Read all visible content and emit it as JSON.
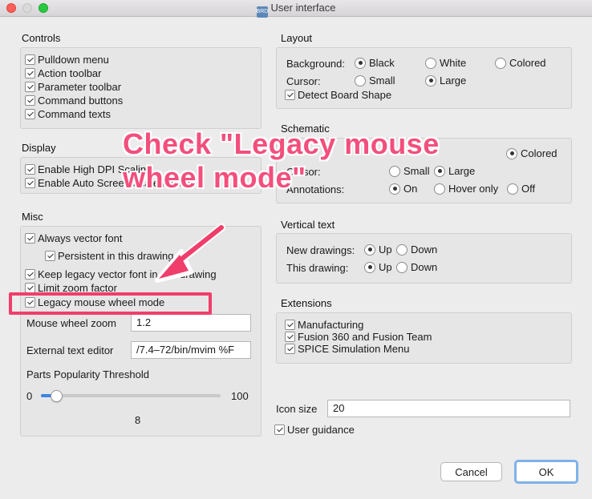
{
  "window": {
    "title": "User interface",
    "app_icon_label": "BRD"
  },
  "colors": {
    "accent": "#3b86e0",
    "annotation": "#f34f7d",
    "highlight_border": "#f03e6b"
  },
  "controls": {
    "title": "Controls",
    "items": [
      "Pulldown menu",
      "Action toolbar",
      "Parameter toolbar",
      "Command buttons",
      "Command texts"
    ]
  },
  "display": {
    "title": "Display",
    "items": [
      "Enable High DPI Scaling",
      "Enable Auto Screen Scale Factor"
    ]
  },
  "misc": {
    "title": "Misc",
    "always_vector_font": "Always vector font",
    "persistent": "Persistent in this drawing",
    "keep_legacy": "Keep legacy vector font in this drawing",
    "limit_zoom": "Limit zoom factor",
    "legacy_mouse": "Legacy mouse wheel mode",
    "mouse_wheel_zoom_label": "Mouse wheel zoom",
    "mouse_wheel_zoom_value": "1.2",
    "external_editor_label": "External text editor",
    "external_editor_value": "/7.4–72/bin/mvim %F",
    "popularity_label": "Parts Popularity Threshold",
    "slider_min": "0",
    "slider_max": "100",
    "slider_value": "8",
    "slider_fraction": 0.08
  },
  "layout": {
    "title": "Layout",
    "background_label": "Background:",
    "background_options": [
      "Black",
      "White",
      "Colored"
    ],
    "cursor_label": "Cursor:",
    "cursor_options": [
      "Small",
      "Large"
    ],
    "detect_board_shape": "Detect Board Shape"
  },
  "schematic": {
    "title": "Schematic",
    "colored": "Colored",
    "cursor_label": "Cursor:",
    "cursor_options": [
      "Small",
      "Large"
    ],
    "annotations_label": "Annotations:",
    "annotation_options": [
      "On",
      "Hover only",
      "Off"
    ]
  },
  "vertical_text": {
    "title": "Vertical text",
    "new_drawings_label": "New drawings:",
    "this_drawing_label": "This drawing:",
    "up": "Up",
    "down": "Down"
  },
  "extensions": {
    "title": "Extensions",
    "items": [
      "Manufacturing",
      "Fusion 360 and Fusion Team",
      "SPICE Simulation Menu"
    ]
  },
  "icon_size": {
    "label": "Icon size",
    "value": "20"
  },
  "user_guidance": "User guidance",
  "buttons": {
    "cancel": "Cancel",
    "ok": "OK"
  },
  "annotation": {
    "line1": "Check \"Legacy mouse",
    "line2": "wheel mode\""
  }
}
